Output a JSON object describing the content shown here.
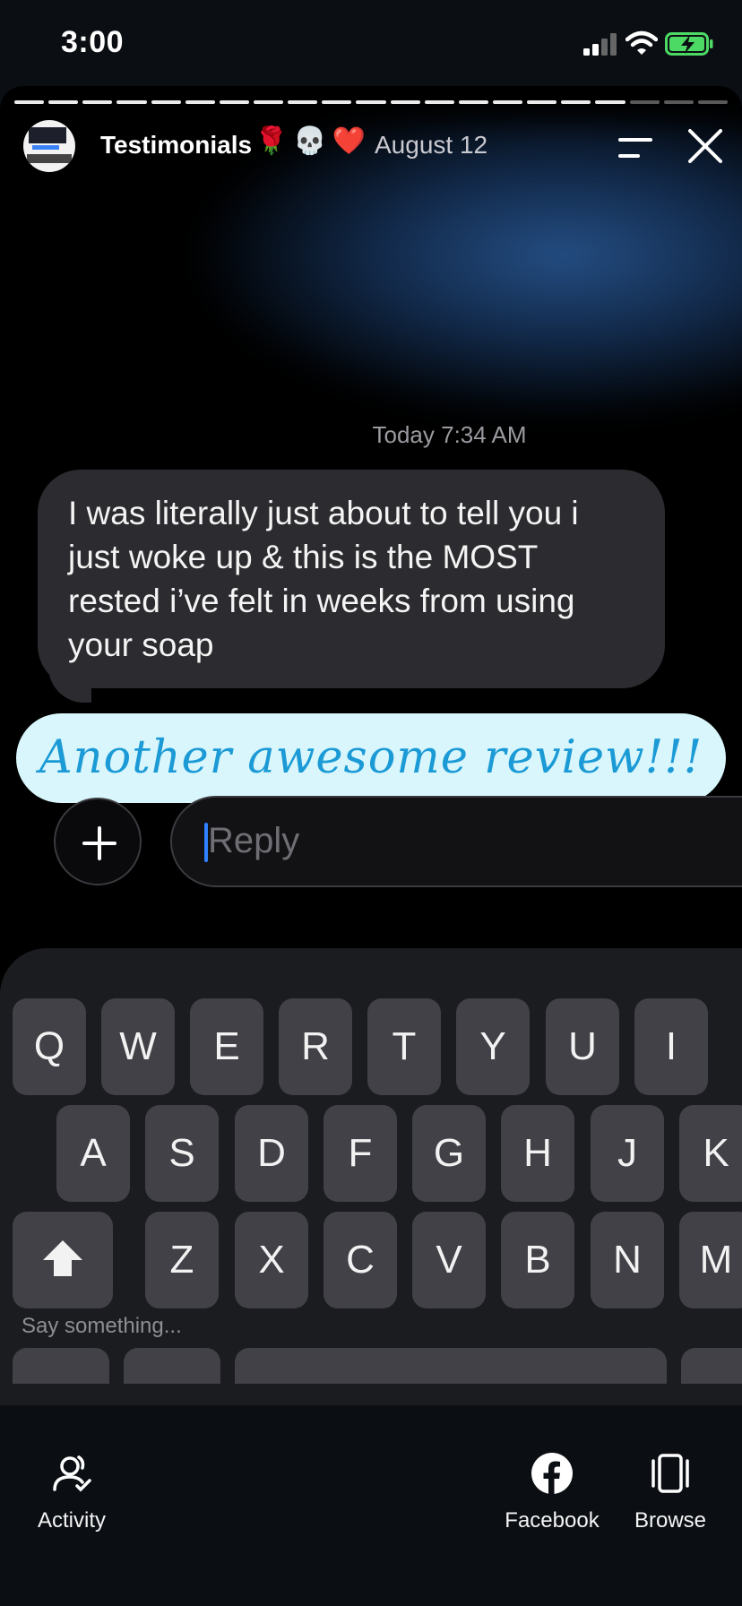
{
  "status": {
    "time": "3:00"
  },
  "story": {
    "account": "Testimonials",
    "emojis": [
      "🌹",
      "💀",
      "❤️"
    ],
    "date": "August 12",
    "progress": {
      "total": 21,
      "done": 18
    },
    "timestamp": "Today 7:34 AM",
    "message": "I was literally just about to tell you i just woke up & this is the MOST rested i’ve felt in weeks from using your soap",
    "banner": "Another awesome review!!!"
  },
  "reply": {
    "placeholder": "Reply"
  },
  "keyboard": {
    "row1": [
      "Q",
      "W",
      "E",
      "R",
      "T",
      "Y",
      "U",
      "I"
    ],
    "row2": [
      "A",
      "S",
      "D",
      "F",
      "G",
      "H",
      "J",
      "K"
    ],
    "row3": [
      "Z",
      "X",
      "C",
      "V",
      "B",
      "N",
      "M"
    ],
    "hint": "Say something..."
  },
  "bottom_nav": {
    "activity": "Activity",
    "facebook": "Facebook",
    "browse": "Browse"
  },
  "colors": {
    "banner_bg": "#d8f6fb",
    "banner_text": "#1b9ad6",
    "battery": "#4cd964"
  }
}
